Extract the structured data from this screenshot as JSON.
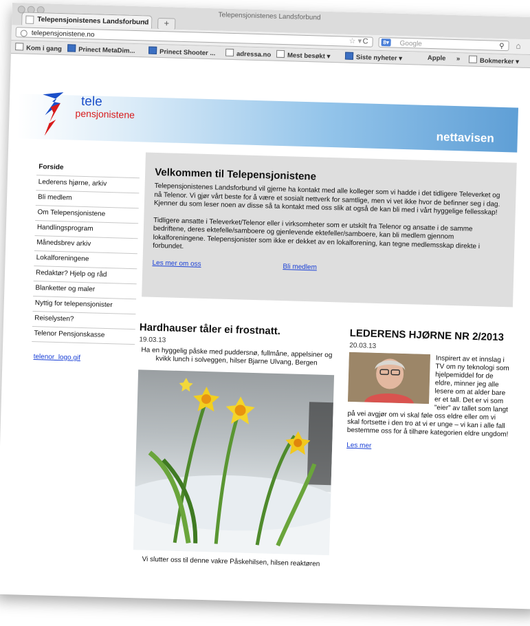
{
  "browser": {
    "window_title": "Telepensjonistenes Landsforbund",
    "tab_label": "Telepensjonistenes Landsforbund",
    "tab_close": "×",
    "new_tab": "+",
    "url": "telepensjonistene.no",
    "search_placeholder": "Google",
    "search_engine_icon": "google-icon",
    "bookmarks": [
      {
        "label": "Kom i gang",
        "icon": "page-icon"
      },
      {
        "label": "Prinect MetaDim...",
        "icon": "app-icon"
      },
      {
        "label": "Prinect Shooter ...",
        "icon": "app-icon"
      },
      {
        "label": "adressa.no",
        "icon": "site-icon"
      },
      {
        "label": "Mest besøkt ▾",
        "icon": "folder-icon"
      },
      {
        "label": "Siste nyheter ▾",
        "icon": "rss-icon"
      },
      {
        "label": "Apple",
        "icon": "apple-icon"
      },
      {
        "label": "»",
        "icon": ""
      },
      {
        "label": "Bokmerker ▾",
        "icon": "bookmarks-icon"
      }
    ]
  },
  "site": {
    "logo_line1": "tele",
    "logo_line2": "pensjonistene",
    "header_title": "nettavisen",
    "colors": {
      "brand_blue": "#1b4fc9",
      "brand_red": "#d81b1b",
      "header_blue": "#5f9fd6",
      "link": "#1a40d6"
    },
    "nav": [
      "Forside",
      "Lederens hjørne, arkiv",
      "Bli medlem",
      "Om Telepensjonistene",
      "Handlingsprogram",
      "Månedsbrev arkiv",
      "Lokalforeningene",
      "Redaktør? Hjelp og råd",
      "Blanketter og maler",
      "Nyttig for telepensjonister",
      "Reiselysten?",
      "Telenor Pensjonskasse"
    ],
    "sidebar_link": "telenor_logo.gif",
    "welcome": {
      "title": "Velkommen til Telepensjonistene",
      "para1": "Telepensjonistenes Landsforbund vil gjerne ha kontakt med alle kolleger som vi hadde i det tidligere Televerket og nå Telenor. Vi gjør vårt beste for å være et sosialt nettverk for samtlige, men vi vet ikke hvor de befinner seg i dag. Kjenner du som leser noen av disse så ta kontakt med oss slik at også de kan bli med i vårt hyggelige fellesskap!",
      "para2": "Tidligere ansatte i Televerket/Telenor eller i virksomheter som er utskilt fra Telenor og ansatte i de samme bedriftene, deres ektefelle/samboere og gjenlevende ektefeller/samboere, kan bli medlem gjennom lokalforeningene. Telepensjonister som ikke er dekket av en lokalforening, kan tegne medlemsskap direkte i forbundet.",
      "link_more": "Les mer om oss",
      "link_join": "Bli medlem"
    },
    "article1": {
      "title": "Hardhauser tåler ei frostnatt.",
      "date": "19.03.13",
      "intro": "Ha en hyggelig påske med puddersnø, fullmåne, appelsiner og kvikk lunch i solveggen, hilser Bjarne Ulvang, Bergen",
      "caption": "Vi slutter oss til denne vakre Påskehilsen, hilsen reaktøren"
    },
    "article2": {
      "title": "LEDERENS HJØRNE NR 2/2013",
      "date": "20.03.13",
      "body": "Inspirert av et innslag i TV om ny teknologi som hjelpemiddel for de eldre, minner jeg alle lesere om at alder bare er et tall. Det er vi som \"eier\" av tallet som langt på vei avgjør om vi skal føle oss eldre eller om vi skal fortsette i den tro at vi er unge – vi kan i alle fall bestemme oss for å tilhøre kategorien eldre ungdom!",
      "more": "Les mer"
    }
  }
}
